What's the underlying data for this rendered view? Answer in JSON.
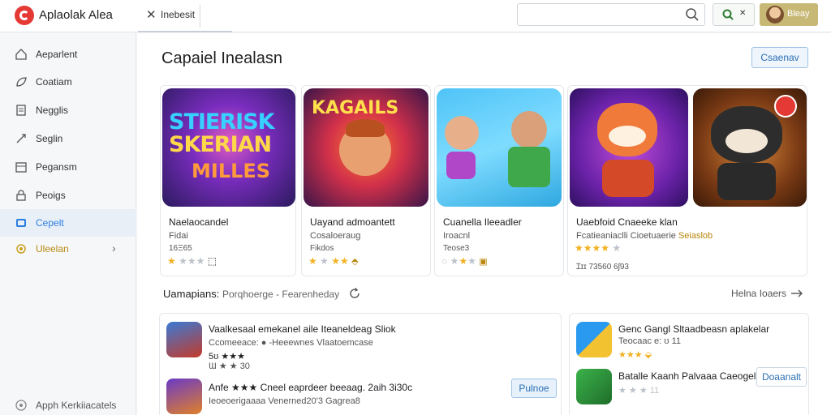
{
  "topbar": {
    "app_title": "Aplaolak Alea",
    "tab_label": "Inebesit",
    "search_placeholder": "",
    "small_button_label": "",
    "user_button_label": "Bleay"
  },
  "sidebar": {
    "items": [
      {
        "label": "Aeparlent",
        "icon": "home-icon"
      },
      {
        "label": "Coatiam",
        "icon": "leaf-icon"
      },
      {
        "label": "Negglis",
        "icon": "document-icon"
      },
      {
        "label": "Seglin",
        "icon": "link-icon"
      },
      {
        "label": "Pegansm",
        "icon": "calendar-icon"
      },
      {
        "label": "Peoigs",
        "icon": "lock-icon"
      },
      {
        "label": "Cepelt",
        "icon": "grid-icon",
        "active": true
      },
      {
        "label": "Uleelan",
        "icon": "settings-icon",
        "has_chevron": true
      }
    ],
    "footer_label": "Apph Kerkiiacatels"
  },
  "main": {
    "page_title": "Capaiel Inealasn",
    "header_button": "Csaenav",
    "cards": [
      {
        "title": "Naelaocandel",
        "dev": "Fidai",
        "downloads": "16Ξ65",
        "stars": 1,
        "rating_suffix": "⬚",
        "art_text": [
          "STIERISK",
          "SKERIAN",
          "MILLES"
        ]
      },
      {
        "title": "Uayand admoantett",
        "dev": "Cosaloeraug",
        "downloads": "Fikdos",
        "stars": 3,
        "rating_suffix": "⬘",
        "art_text": [
          "KAGAILS"
        ]
      },
      {
        "title": "Cuanella Ileeadler",
        "dev": "Iroacnl",
        "downloads": "Teose3",
        "stars": 1,
        "rating_suffix": "▣",
        "art_text": []
      },
      {
        "title": "Uaebfoid Cnaeeke klan",
        "dev": "Fcatieaniaclli Cioetuaerie",
        "badge": "Seiaslob",
        "downloads": "Ɪɪɪ 73560 6ʃ93",
        "stars": 4,
        "rating_suffix": "",
        "art_text": []
      },
      {
        "title": "",
        "dev": "",
        "downloads": "",
        "stars": 0,
        "rating_suffix": "",
        "art_text": []
      }
    ],
    "section": {
      "title": "Uamapians:",
      "subtitle": "Porqhoerge - Fearenheday",
      "see_more": "Helna Ioaers"
    },
    "list_left": [
      {
        "title": "Vaalkesaal emekanel aile Iteaneldeag Sliok",
        "meta": "Ccomeeace: ● -Heeewnes Vlaatoemcase",
        "rating": "5ʊ ★★★",
        "rating2": "Ɯ ★ ★ 30"
      },
      {
        "title": "Anfe ★★★ Cneel eaprdeer beeaag. 2aih 3i30c",
        "meta": "Ieoeoerigaaaa Venerned20'3 Gagrea8",
        "button": "Pulnoe"
      }
    ],
    "list_right": [
      {
        "title": "Genc Gangl Sltaadbeasn aplakelar",
        "meta": "Teocaac e: ʊ 11",
        "rating": "★★★ ⬙"
      },
      {
        "title": "Batalle Kaanh Palvaaa Caeogel",
        "meta": "",
        "rating": "★ ★ ★ 11",
        "button": "Doaanalt"
      }
    ]
  },
  "colors": {
    "accent": "#2a7de1",
    "star": "#f2b01e",
    "user_button": "#c8b876",
    "logo": "#e53935"
  }
}
